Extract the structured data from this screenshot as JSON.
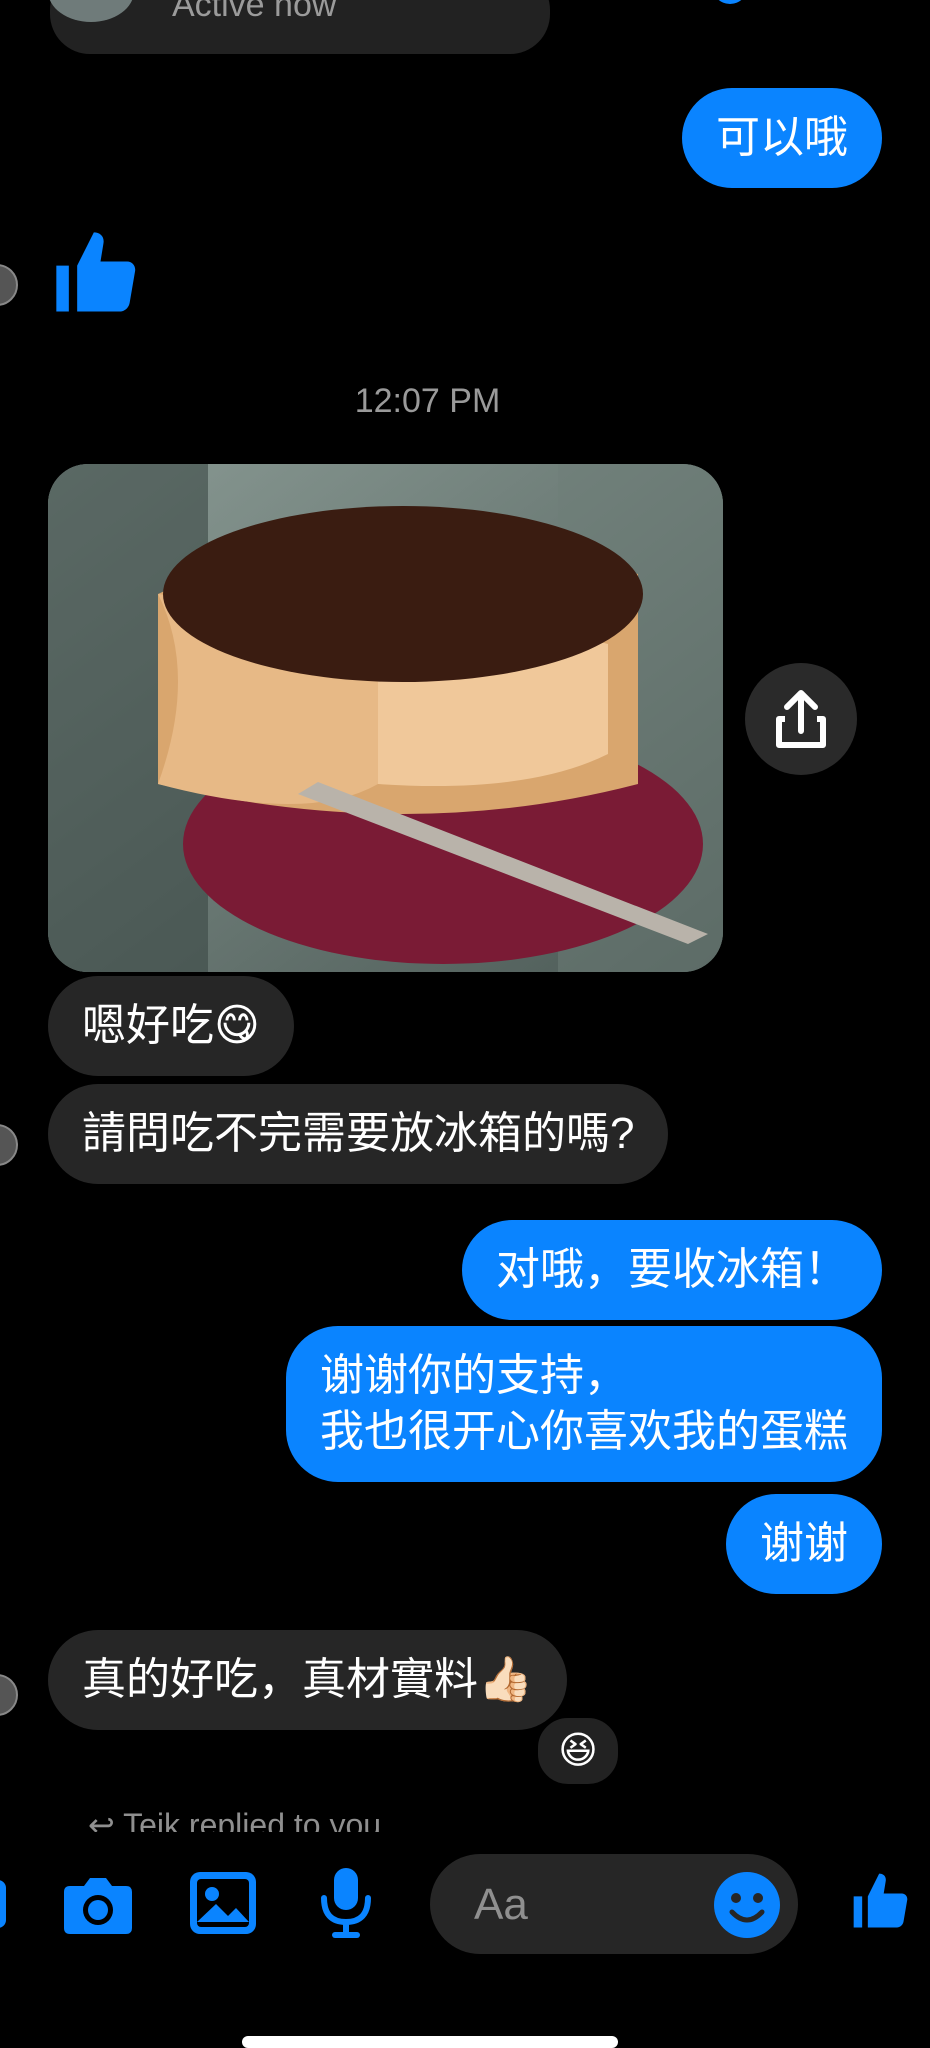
{
  "header": {
    "status": "Active now"
  },
  "messages": {
    "out_1": "可以哦",
    "timestamp": "12:07 PM",
    "in_1": "嗯好吃😋",
    "in_2": "請問吃不完需要放冰箱的嗎?",
    "out_2": "对哦，要收冰箱！",
    "out_3_line1": "谢谢你的支持，",
    "out_3_line2": "我也很开心你喜欢我的蛋糕",
    "out_4": "谢谢",
    "in_3": "真的好吃，真材實料👍🏻",
    "reaction": "😆",
    "reply_note": "Teik replied to you"
  },
  "composer": {
    "placeholder": "Aa"
  },
  "icons": {
    "like": "thumbs-up-icon",
    "camera": "camera-icon",
    "gallery": "image-icon",
    "mic": "microphone-icon",
    "emoji": "smiley-icon",
    "share": "share-icon"
  },
  "colors": {
    "accent": "#0a84ff",
    "incoming": "#262626",
    "background": "#000000"
  }
}
